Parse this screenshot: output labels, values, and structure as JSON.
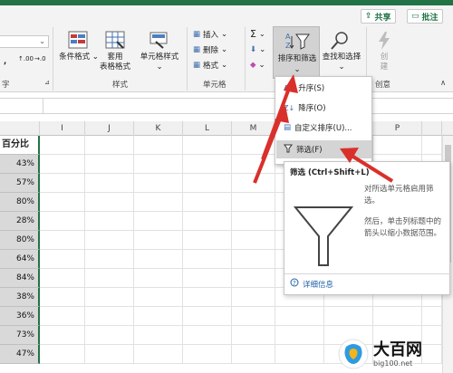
{
  "header": {
    "share_label": "共享",
    "comment_label": "批注"
  },
  "ribbon": {
    "conditional_format_label": "条件格式",
    "table_format_label_1": "套用",
    "table_format_label_2": "表格格式",
    "cell_style_label": "单元格样式",
    "styles_group_label": "样式",
    "insert_label": "插入",
    "delete_label": "删除",
    "format_label": "格式",
    "cells_group_label": "单元格",
    "sort_filter_label": "排序和筛选",
    "find_select_label": "查找和选择",
    "create_label_1": "创",
    "create_label_2": "建",
    "create_group_label": "创意",
    "left_group_label": "字",
    "number_format_symbols": [
      "↑.00",
      "→.0"
    ]
  },
  "columns": [
    "I",
    "J",
    "K",
    "L",
    "M",
    "P"
  ],
  "sheet": {
    "header_cell": "百分比",
    "values": [
      "43%",
      "57%",
      "80%",
      "28%",
      "80%",
      "64%",
      "84%",
      "38%",
      "36%",
      "73%",
      "47%"
    ]
  },
  "sort_menu": {
    "items": [
      {
        "label": "升序(S)"
      },
      {
        "label": "降序(O)"
      },
      {
        "label": "自定义排序(U)..."
      },
      {
        "label": "筛选(F)"
      }
    ]
  },
  "tooltip": {
    "title": "筛选 (Ctrl+Shift+L)",
    "desc": "对所选单元格启用筛选。",
    "desc2": "然后，单击列标题中的箭头以缩小数据范围。",
    "more_info": "详细信息"
  },
  "watermark": {
    "title": "大百网",
    "url": "big100.net"
  },
  "colors": {
    "excel_green": "#217346",
    "arrow_red": "#d9302b",
    "link_blue": "#1f5fa8"
  }
}
